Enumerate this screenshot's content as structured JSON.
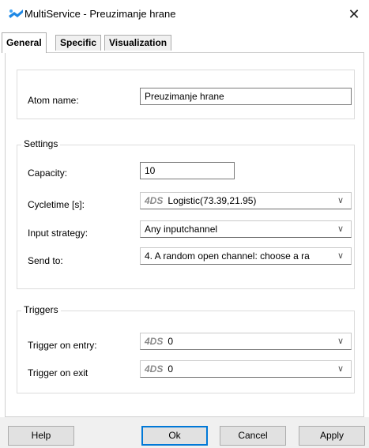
{
  "window": {
    "title": "MultiService - Preuzimanje hrane",
    "close_glyph": "✕"
  },
  "tabs": [
    {
      "label": "General",
      "active": true
    },
    {
      "label": "Specific",
      "active": false
    },
    {
      "label": "Visualization",
      "active": false
    }
  ],
  "atom": {
    "label": "Atom name:",
    "value": "Preuzimanje hrane"
  },
  "settings": {
    "title": "Settings",
    "capacity_label": "Capacity:",
    "capacity_value": "10",
    "cycletime_label": "Cycletime [s]:",
    "cycletime_tag": "4DS",
    "cycletime_value": "Logistic(73.39,21.95)",
    "input_strategy_label": "Input strategy:",
    "input_strategy_value": "Any inputchannel",
    "send_to_label": "Send to:",
    "send_to_value": "4. A random open channel: choose a ra"
  },
  "triggers": {
    "title": "Triggers",
    "entry_label": "Trigger on entry:",
    "entry_tag": "4DS",
    "entry_value": "0",
    "exit_label": "Trigger on exit",
    "exit_tag": "4DS",
    "exit_value": "0"
  },
  "buttons": {
    "help": "Help",
    "ok": "Ok",
    "cancel": "Cancel",
    "apply": "Apply"
  },
  "icons": {
    "app": "multiservice-app-icon",
    "dropdown": "chevron-down-icon"
  },
  "colors": {
    "accent": "#0078d7",
    "app_icon_blue": "#1e88e5"
  }
}
